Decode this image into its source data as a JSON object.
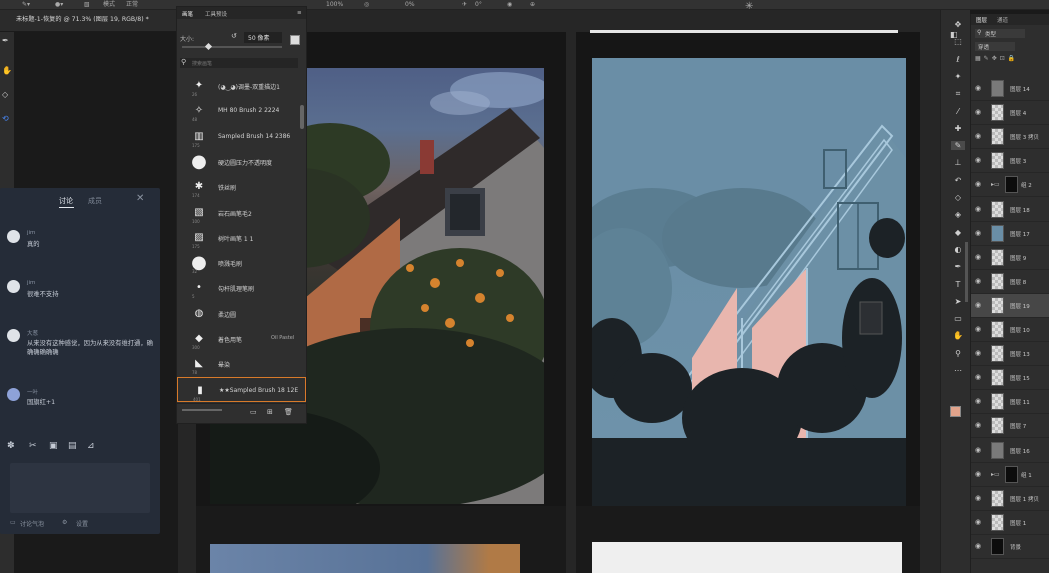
{
  "options_bar": {
    "mode_label": "模式",
    "mode_value": "正常",
    "opacity": "100%",
    "flow": "0%",
    "angle": "0°"
  },
  "document_tab": {
    "title": "未标题-1-恢复的 @ 71.3% (图层 19, RGB/8) *"
  },
  "brush_panel": {
    "tabs": [
      "画笔",
      "工具预设"
    ],
    "size_label": "大小:",
    "size_value": "50 像素",
    "search_placeholder": "搜索画笔",
    "brushes": [
      {
        "size": "26",
        "name": "(◕‿◕)调墨-双重描边1"
      },
      {
        "size": "48",
        "name": "MH 80 Brush 2 2224"
      },
      {
        "size": "175",
        "name": "Sampled Brush 14 2386"
      },
      {
        "size": "",
        "name": "硬边圆压力不透明度"
      },
      {
        "size": "174",
        "name": "铁丝刷"
      },
      {
        "size": "100",
        "name": "岩石画笔毛2"
      },
      {
        "size": "175",
        "name": "树叶画笔 1 1"
      },
      {
        "size": "32",
        "name": "喷溅毛刷"
      },
      {
        "size": "5",
        "name": "勾杆肌理笔刷"
      },
      {
        "size": "",
        "name": "柔边圆"
      },
      {
        "size": "300",
        "name": "着色用笔",
        "extra": "Oil Pastel"
      },
      {
        "size": "78",
        "name": "晕染"
      },
      {
        "size": "401",
        "name": "★★Sampled Brush 18 12E"
      }
    ]
  },
  "chat": {
    "tabs": [
      "讨论",
      "成员"
    ],
    "messages": [
      {
        "name": "jim",
        "text": "真的"
      },
      {
        "name": "jim",
        "text": "很难不支持"
      },
      {
        "name": "大葱",
        "text": "从来没有这种感觉，因为从来没有维打通，确确确确确确"
      },
      {
        "name": "一叶",
        "text": "国旗红+1"
      }
    ],
    "footer_left": "讨论气泡",
    "footer_right": "设置"
  },
  "layers_panel": {
    "tabs": [
      "图层",
      "通道"
    ],
    "filter_label": "类型",
    "blend_mode": "穿透",
    "layers": [
      {
        "name": "图层 14",
        "thumb": "gray",
        "selected": false,
        "group": false
      },
      {
        "name": "图层 4",
        "thumb": "check",
        "selected": false,
        "group": false
      },
      {
        "name": "图层 3 拷贝",
        "thumb": "check",
        "selected": false,
        "group": false
      },
      {
        "name": "图层 3",
        "thumb": "check",
        "selected": false,
        "group": false
      },
      {
        "name": "组 2",
        "thumb": "black",
        "selected": false,
        "group": true
      },
      {
        "name": "图层 18",
        "thumb": "check",
        "selected": false,
        "group": false
      },
      {
        "name": "图层 17",
        "thumb": "blue",
        "selected": false,
        "group": false
      },
      {
        "name": "图层 9",
        "thumb": "check",
        "selected": false,
        "group": false
      },
      {
        "name": "图层 8",
        "thumb": "check",
        "selected": false,
        "group": false
      },
      {
        "name": "图层 19",
        "thumb": "check",
        "selected": true,
        "group": false
      },
      {
        "name": "图层 10",
        "thumb": "check",
        "selected": false,
        "group": false
      },
      {
        "name": "图层 13",
        "thumb": "check",
        "selected": false,
        "group": false
      },
      {
        "name": "图层 15",
        "thumb": "check",
        "selected": false,
        "group": false
      },
      {
        "name": "图层 11",
        "thumb": "check",
        "selected": false,
        "group": false
      },
      {
        "name": "图层 7",
        "thumb": "check",
        "selected": false,
        "group": false
      },
      {
        "name": "图层 16",
        "thumb": "gray",
        "selected": false,
        "group": false
      },
      {
        "name": "组 1",
        "thumb": "black",
        "selected": false,
        "group": true
      },
      {
        "name": "图层 1 拷贝",
        "thumb": "check",
        "selected": false,
        "group": false
      },
      {
        "name": "图层 1",
        "thumb": "check",
        "selected": false,
        "group": false
      },
      {
        "name": "背景",
        "thumb": "black",
        "selected": false,
        "group": false
      }
    ]
  },
  "colors": {
    "foreground": "#e2a48c",
    "background": "#ffffff",
    "illus_sky": "#6a8ea6",
    "illus_wall": "#e8b6ae"
  },
  "icons": [
    "move-icon",
    "brush-icon",
    "eye-icon",
    "search-icon",
    "trash-icon",
    "folder-icon",
    "new-item-icon",
    "close-icon",
    "image-icon",
    "emoji-icon",
    "scissors-icon",
    "settings-icon"
  ]
}
